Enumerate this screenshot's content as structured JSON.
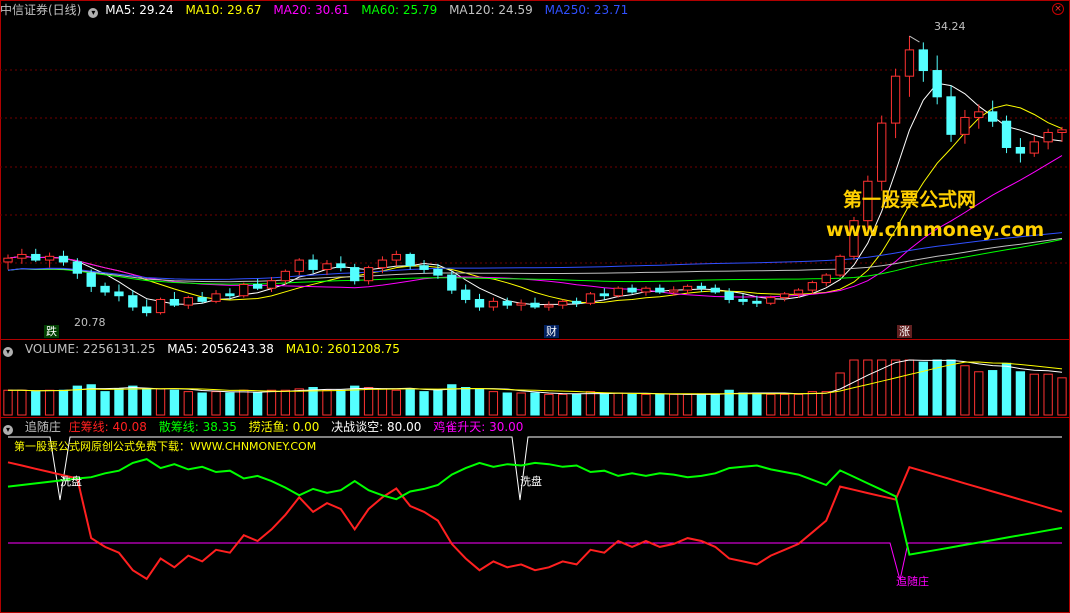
{
  "panel1": {
    "stock": "中信证券(日线)",
    "ma": [
      {
        "label": "MA5: 29.24",
        "color": "#ffffff"
      },
      {
        "label": "MA10: 29.67",
        "color": "#ffff00"
      },
      {
        "label": "MA20: 30.61",
        "color": "#ff00ff"
      },
      {
        "label": "MA60: 25.79",
        "color": "#00ff00"
      },
      {
        "label": "MA120: 24.59",
        "color": "#c0c0c0"
      },
      {
        "label": "MA250: 23.71",
        "color": "#3050ff"
      }
    ],
    "high_label": "34.24",
    "low_label": "20.78",
    "tag_left": "跌",
    "tag_mid": "财",
    "tag_right": "涨",
    "watermark_cn": "第一股票公式网",
    "watermark_url": "www.chnmoney.com"
  },
  "panel2": {
    "title": "VOLUME: 2256131.25",
    "ma5": "MA5: 2056243.38",
    "ma10": "MA10: 2601208.75"
  },
  "panel3": {
    "title": "追随庄",
    "items": [
      {
        "label": "庄筹线: 40.08",
        "color": "#ff2020"
      },
      {
        "label": "散筹线: 38.35",
        "color": "#00ff00"
      },
      {
        "label": "捞活鱼: 0.00",
        "color": "#ffff00"
      },
      {
        "label": "决战谈空: 80.00",
        "color": "#ffffff"
      },
      {
        "label": "鸡雀升天: 30.00",
        "color": "#ff00ff"
      }
    ],
    "promo": "第一股票公式网原创公式免费下载：WWW.CHNMONEY.COM",
    "xipan1": "洗盘",
    "xipan2": "洗盘",
    "zhuizhuang": "追随庄"
  },
  "chart_data": {
    "type": "candlestick",
    "candles_ohlc": [
      [
        22.2,
        22.6,
        21.8,
        22.4
      ],
      [
        22.4,
        22.9,
        22.1,
        22.6
      ],
      [
        22.6,
        22.9,
        22.2,
        22.3
      ],
      [
        22.3,
        22.7,
        21.9,
        22.5
      ],
      [
        22.5,
        22.8,
        22.0,
        22.2
      ],
      [
        22.2,
        22.4,
        21.3,
        21.6
      ],
      [
        21.6,
        21.8,
        20.6,
        20.9
      ],
      [
        20.9,
        21.1,
        20.4,
        20.6
      ],
      [
        20.6,
        21.0,
        20.1,
        20.4
      ],
      [
        20.4,
        20.7,
        19.6,
        19.8
      ],
      [
        19.8,
        20.2,
        19.3,
        19.5
      ],
      [
        19.5,
        20.3,
        19.4,
        20.2
      ],
      [
        20.2,
        20.6,
        19.8,
        19.9
      ],
      [
        19.9,
        20.4,
        19.7,
        20.3
      ],
      [
        20.3,
        20.6,
        20.0,
        20.1
      ],
      [
        20.1,
        20.7,
        20.0,
        20.5
      ],
      [
        20.5,
        20.8,
        20.2,
        20.4
      ],
      [
        20.4,
        21.1,
        20.3,
        21.0
      ],
      [
        21.0,
        21.3,
        20.7,
        20.8
      ],
      [
        20.8,
        21.4,
        20.6,
        21.2
      ],
      [
        21.2,
        21.8,
        21.0,
        21.7
      ],
      [
        21.7,
        22.4,
        21.5,
        22.3
      ],
      [
        22.3,
        22.6,
        21.6,
        21.8
      ],
      [
        21.8,
        22.3,
        21.5,
        22.1
      ],
      [
        22.1,
        22.5,
        21.7,
        21.9
      ],
      [
        21.9,
        22.1,
        21.0,
        21.2
      ],
      [
        21.2,
        22.0,
        21.0,
        21.9
      ],
      [
        21.9,
        22.5,
        21.6,
        22.3
      ],
      [
        22.3,
        22.8,
        22.0,
        22.6
      ],
      [
        22.6,
        22.7,
        21.8,
        22.0
      ],
      [
        22.0,
        22.3,
        21.6,
        21.8
      ],
      [
        21.8,
        22.1,
        21.3,
        21.5
      ],
      [
        21.5,
        21.7,
        20.5,
        20.7
      ],
      [
        20.7,
        21.0,
        20.0,
        20.2
      ],
      [
        20.2,
        20.5,
        19.6,
        19.8
      ],
      [
        19.8,
        20.3,
        19.6,
        20.1
      ],
      [
        20.1,
        20.3,
        19.7,
        19.9
      ],
      [
        19.9,
        20.2,
        19.6,
        20.0
      ],
      [
        20.0,
        20.3,
        19.7,
        19.8
      ],
      [
        19.8,
        20.1,
        19.6,
        19.9
      ],
      [
        19.9,
        20.2,
        19.7,
        20.1
      ],
      [
        20.1,
        20.3,
        19.8,
        20.0
      ],
      [
        20.0,
        20.6,
        19.9,
        20.5
      ],
      [
        20.5,
        20.8,
        20.2,
        20.4
      ],
      [
        20.4,
        20.9,
        20.3,
        20.8
      ],
      [
        20.8,
        21.0,
        20.5,
        20.6
      ],
      [
        20.6,
        20.9,
        20.4,
        20.8
      ],
      [
        20.8,
        21.0,
        20.5,
        20.6
      ],
      [
        20.6,
        20.9,
        20.4,
        20.7
      ],
      [
        20.7,
        21.0,
        20.5,
        20.9
      ],
      [
        20.9,
        21.1,
        20.6,
        20.8
      ],
      [
        20.8,
        21.0,
        20.5,
        20.6
      ],
      [
        20.6,
        20.8,
        20.0,
        20.2
      ],
      [
        20.2,
        20.5,
        19.9,
        20.1
      ],
      [
        20.1,
        20.4,
        19.8,
        20.0
      ],
      [
        20.0,
        20.4,
        19.9,
        20.3
      ],
      [
        20.3,
        20.6,
        20.1,
        20.5
      ],
      [
        20.5,
        20.8,
        20.3,
        20.7
      ],
      [
        20.7,
        21.2,
        20.5,
        21.1
      ],
      [
        21.1,
        21.6,
        20.9,
        21.5
      ],
      [
        21.5,
        22.6,
        21.4,
        22.5
      ],
      [
        22.5,
        24.6,
        22.3,
        24.4
      ],
      [
        24.4,
        26.8,
        24.0,
        26.5
      ],
      [
        26.5,
        30.0,
        26.0,
        29.6
      ],
      [
        29.6,
        32.5,
        28.8,
        32.1
      ],
      [
        32.1,
        34.24,
        31.0,
        33.5
      ],
      [
        33.5,
        33.9,
        31.8,
        32.4
      ],
      [
        32.4,
        33.2,
        30.6,
        31.0
      ],
      [
        31.0,
        31.6,
        28.6,
        29.0
      ],
      [
        29.0,
        30.3,
        28.5,
        29.9
      ],
      [
        29.9,
        30.6,
        29.3,
        30.2
      ],
      [
        30.2,
        30.8,
        29.4,
        29.7
      ],
      [
        29.7,
        30.0,
        28.0,
        28.3
      ],
      [
        28.3,
        28.8,
        27.5,
        28.0
      ],
      [
        28.0,
        28.9,
        27.8,
        28.6
      ],
      [
        28.6,
        29.3,
        28.2,
        29.1
      ],
      [
        29.1,
        29.4,
        28.6,
        29.24
      ]
    ],
    "high_marker": 34.24,
    "low_marker": 20.78,
    "ma_legend": [
      "MA5",
      "MA10",
      "MA20",
      "MA60",
      "MA120",
      "MA250"
    ],
    "volume_last": 2256131.25,
    "indicator_last": {
      "庄筹线": 40.08,
      "散筹线": 38.35,
      "捞活鱼": 0.0,
      "决战谈空": 80.0,
      "鸡雀升天": 30.0
    }
  }
}
